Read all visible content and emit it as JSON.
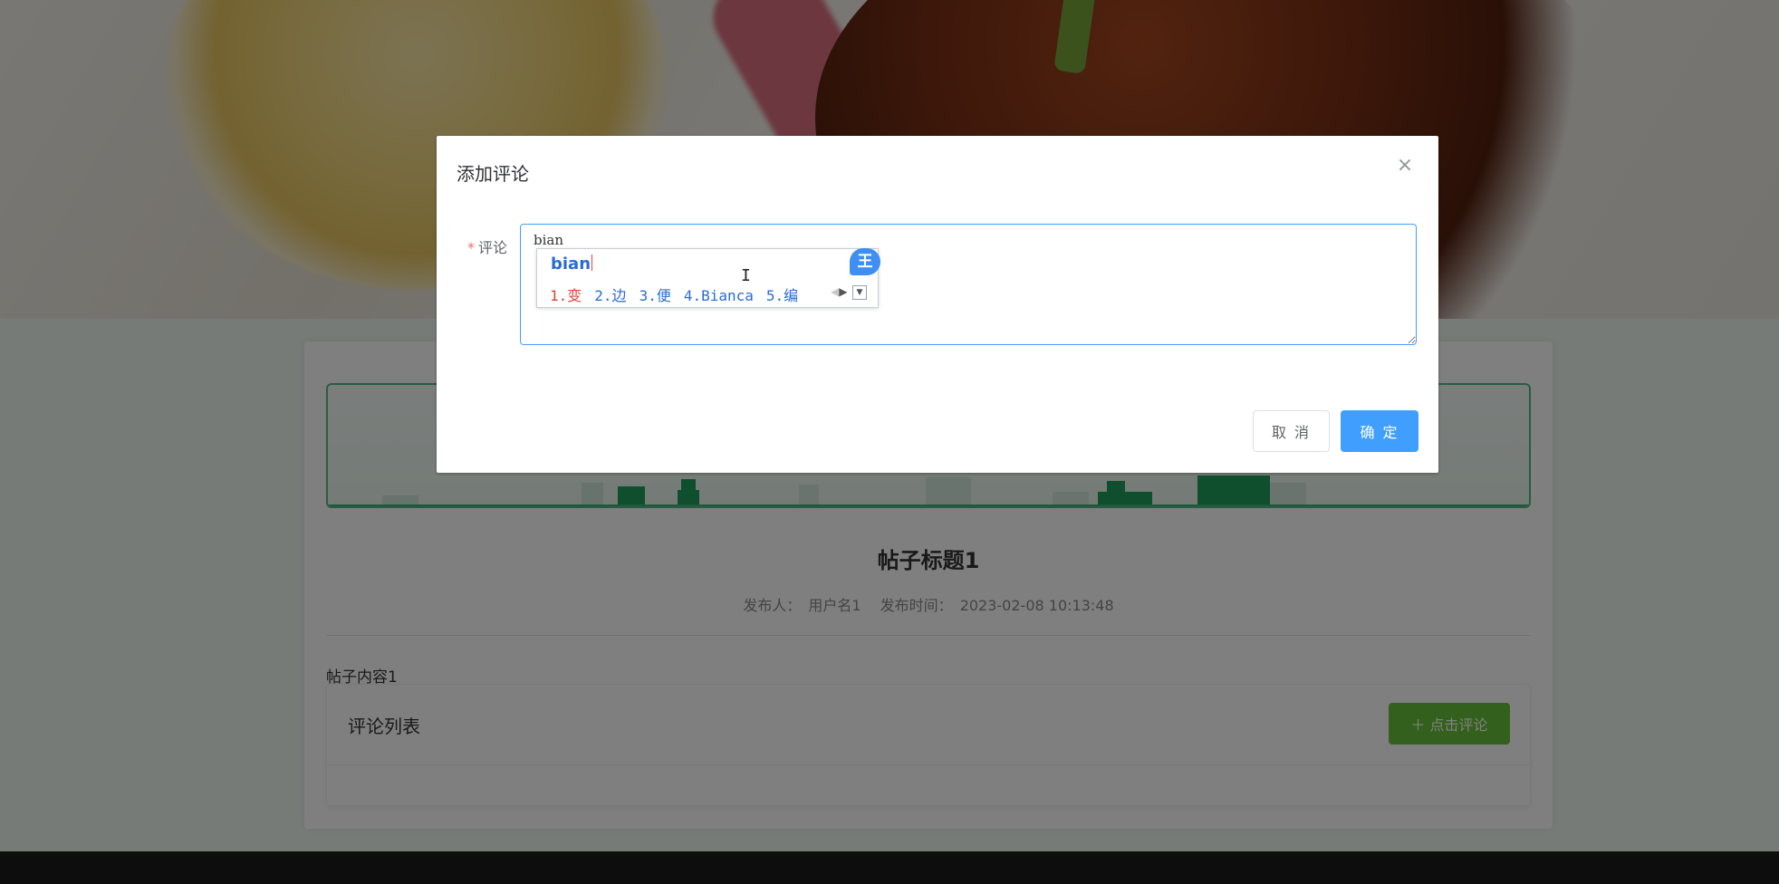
{
  "page": {
    "post": {
      "title": "帖子标题1",
      "author_label": "发布人：",
      "author": "用户名1",
      "time_label": "发布时间：",
      "time": "2023-02-08 10:13:48",
      "content": "帖子内容1"
    },
    "comments": {
      "title": "评论列表",
      "add_button_icon": "plus-icon",
      "add_button_label": "＋ 点击评论"
    }
  },
  "dialog": {
    "title": "添加评论",
    "close_icon": "close-icon",
    "close_symbol": "×",
    "field_label": "评论",
    "required_mark": "*",
    "textarea_value": "bian",
    "cancel_label": "取 消",
    "confirm_label": "确 定"
  },
  "ime": {
    "composition": "bian",
    "candidates": [
      "1.变",
      "2.边",
      "3.便",
      "4.Bianca",
      "5.编"
    ],
    "active_index": 0,
    "prev_symbol": "◀",
    "next_symbol": "▶",
    "dropdown_symbol": "▼",
    "logo_text": "王"
  },
  "colors": {
    "primary": "#409eff",
    "success": "#67c23a",
    "danger": "#f56c6c",
    "ime_blue": "#2b6cd1",
    "ime_red": "#e0403a"
  }
}
